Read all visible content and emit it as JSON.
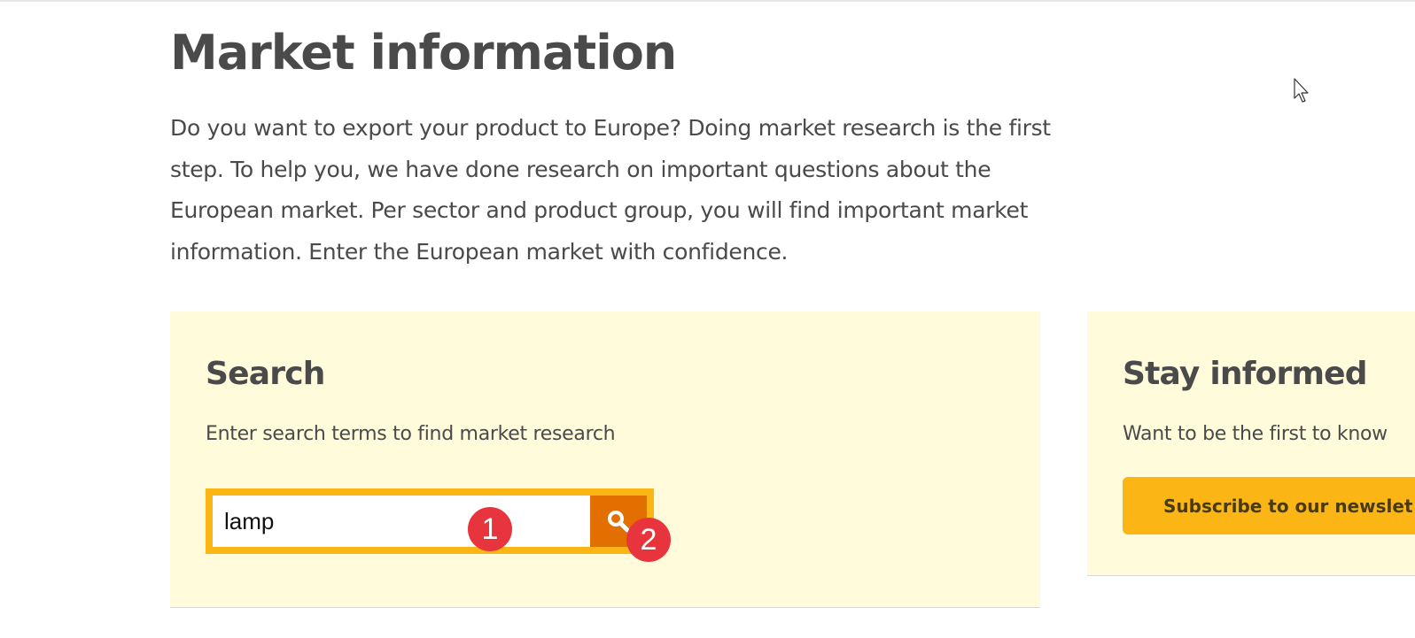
{
  "page": {
    "title": "Market information",
    "intro": "Do you want to export your product to Europe? Doing market research is the first step. To help you, we have done research on important questions about the European market. Per sector and product group, you will find important market information. Enter the European market with confidence."
  },
  "search": {
    "heading": "Search",
    "description": "Enter search terms to find market research",
    "input_value": "lamp",
    "button_icon": "search-icon"
  },
  "newsletter": {
    "heading": "Stay informed",
    "description": "Want to be the first to know",
    "button_label": "Subscribe to our newslet"
  },
  "annotations": {
    "marker_1": "1",
    "marker_2": "2"
  },
  "colors": {
    "panel_background": "#fffbdb",
    "accent_yellow": "#fbb616",
    "search_button": "#e36f00",
    "marker_red": "#e8343c",
    "text": "#4a4a4a"
  }
}
